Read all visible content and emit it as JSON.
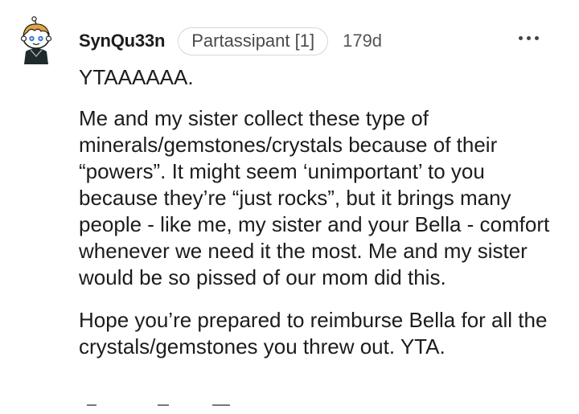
{
  "comment": {
    "username": "SynQu33n",
    "flair": "Partassipant [1]",
    "age": "179d",
    "paragraphs": [
      "YTAAAAAA.",
      "Me and my sister collect these type of minerals/gemstones/crystals because of their “powers”. It might seem ‘unimportant’ to you because they’re “just rocks”, but it brings many people - like me, my sister and your Bella - comfort whenever we need it the most. Me and my sister would be so pissed of our mom did this.",
      "Hope you’re prepared to reimburse Bella for all the crystals/gemstones you threw out. YTA."
    ]
  },
  "icons": {
    "avatar": "snoo-avatar-icon",
    "more": "more-options-icon"
  },
  "colors": {
    "text": "#1c1c1c",
    "muted": "#555555",
    "flair_border": "#d6d6d6"
  }
}
